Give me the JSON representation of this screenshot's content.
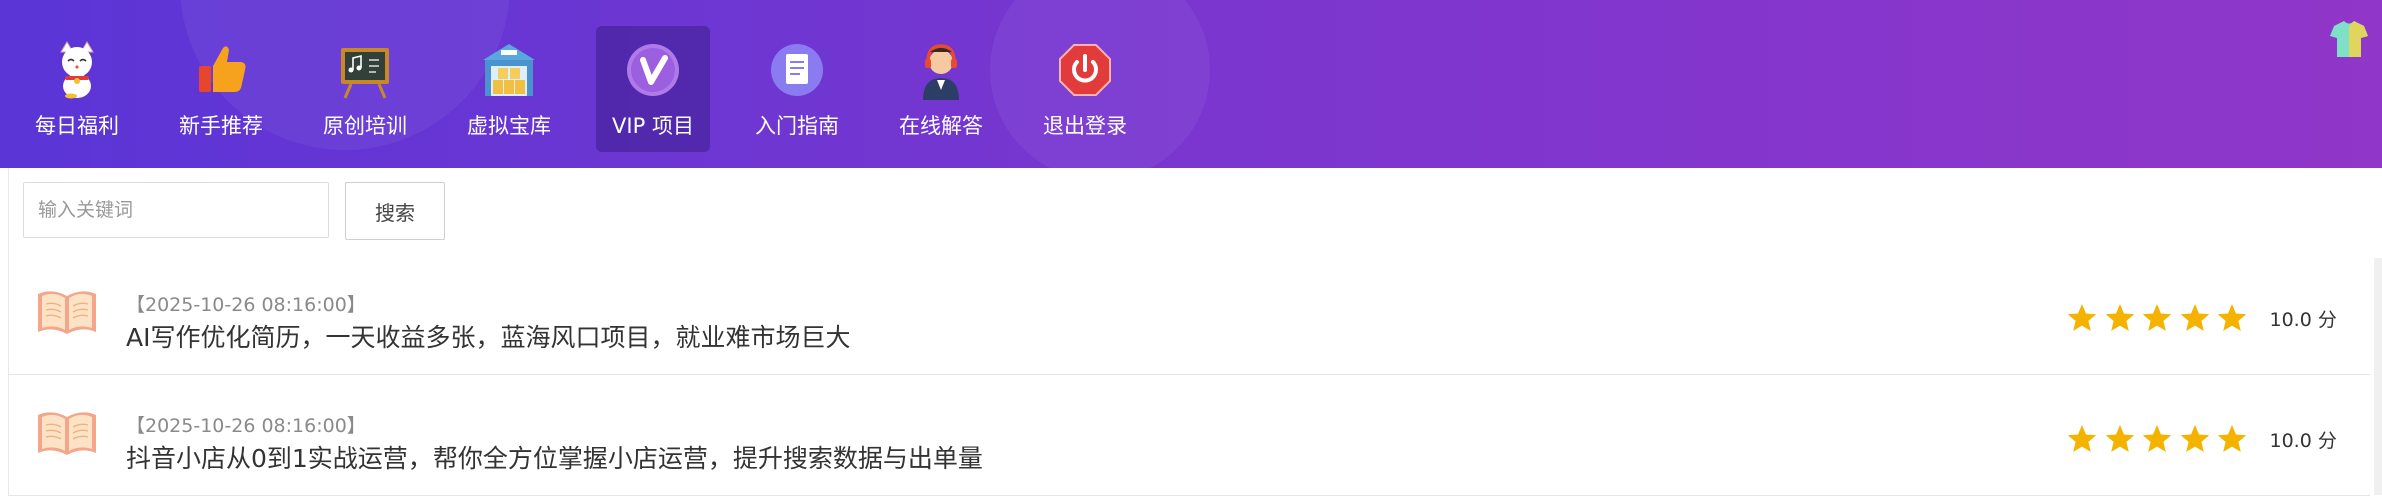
{
  "nav": {
    "items": [
      {
        "label": "每日福利",
        "icon": "lucky-cat-icon"
      },
      {
        "label": "新手推荐",
        "icon": "thumbs-up-icon"
      },
      {
        "label": "原创培训",
        "icon": "chalkboard-icon"
      },
      {
        "label": "虚拟宝库",
        "icon": "warehouse-icon"
      },
      {
        "label": "VIP 项目",
        "icon": "vip-icon",
        "active": true
      },
      {
        "label": "入门指南",
        "icon": "guide-document-icon"
      },
      {
        "label": "在线解答",
        "icon": "support-agent-icon"
      },
      {
        "label": "退出登录",
        "icon": "power-icon"
      }
    ]
  },
  "search": {
    "placeholder": "输入关键词",
    "value": "",
    "button_label": "搜索"
  },
  "list": {
    "items": [
      {
        "date": "【2025-10-26 08:16:00】",
        "title": "AI写作优化简历，一天收益多张，蓝海风口项目，就业难市场巨大",
        "stars": 5,
        "score": "10.0 分"
      },
      {
        "date": "【2025-10-26 08:16:00】",
        "title": "抖音小店从0到1实战运营，帮你全方位掌握小店运营，提升搜索数据与出单量",
        "stars": 5,
        "score": "10.0 分"
      }
    ]
  },
  "colors": {
    "header_start": "#5b35d6",
    "header_end": "#9036c9",
    "star": "#f5b301",
    "book": "#f2997e"
  }
}
